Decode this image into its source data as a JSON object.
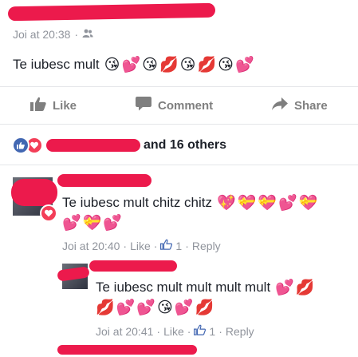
{
  "post": {
    "timestamp": "Joi at 20:38",
    "separator": "·",
    "audience_icon": "friends-icon",
    "text": "Te iubesc mult",
    "emojis": [
      "😘",
      "💕",
      "😘",
      "💋",
      "😘",
      "💋",
      "😘",
      "💕"
    ]
  },
  "actions": {
    "like_label": "Like",
    "comment_label": "Comment",
    "share_label": "Share"
  },
  "reactions": {
    "icons": [
      "like-reaction-icon",
      "love-reaction-icon"
    ],
    "others_text": "and 16 others"
  },
  "comments": [
    {
      "text": "Te iubesc mult chitz chitz",
      "emojis_line1": [
        "💖",
        "💝",
        "💝",
        "💕",
        "💝"
      ],
      "emojis_line2": [
        "💕",
        "💝",
        "💕"
      ],
      "time": "Joi at 20:40",
      "like_label": "Like",
      "like_count": "1",
      "reply_label": "Reply",
      "separator": "·"
    },
    {
      "text": "Te iubesc mult mult mult mult",
      "emojis_line1": [
        "💕",
        "💋"
      ],
      "emojis_line2": [
        "💋",
        "💕",
        "💕",
        "😘",
        "💕",
        "💋"
      ],
      "time": "Joi at 20:41",
      "like_label": "Like",
      "like_count": "1",
      "reply_label": "Reply",
      "separator": "·"
    }
  ],
  "colors": {
    "redaction": "#ec1a4c",
    "meta_gray": "#90949c",
    "text": "#1d2129",
    "like_blue": "#4267b2",
    "love_red": "#f33e58"
  }
}
